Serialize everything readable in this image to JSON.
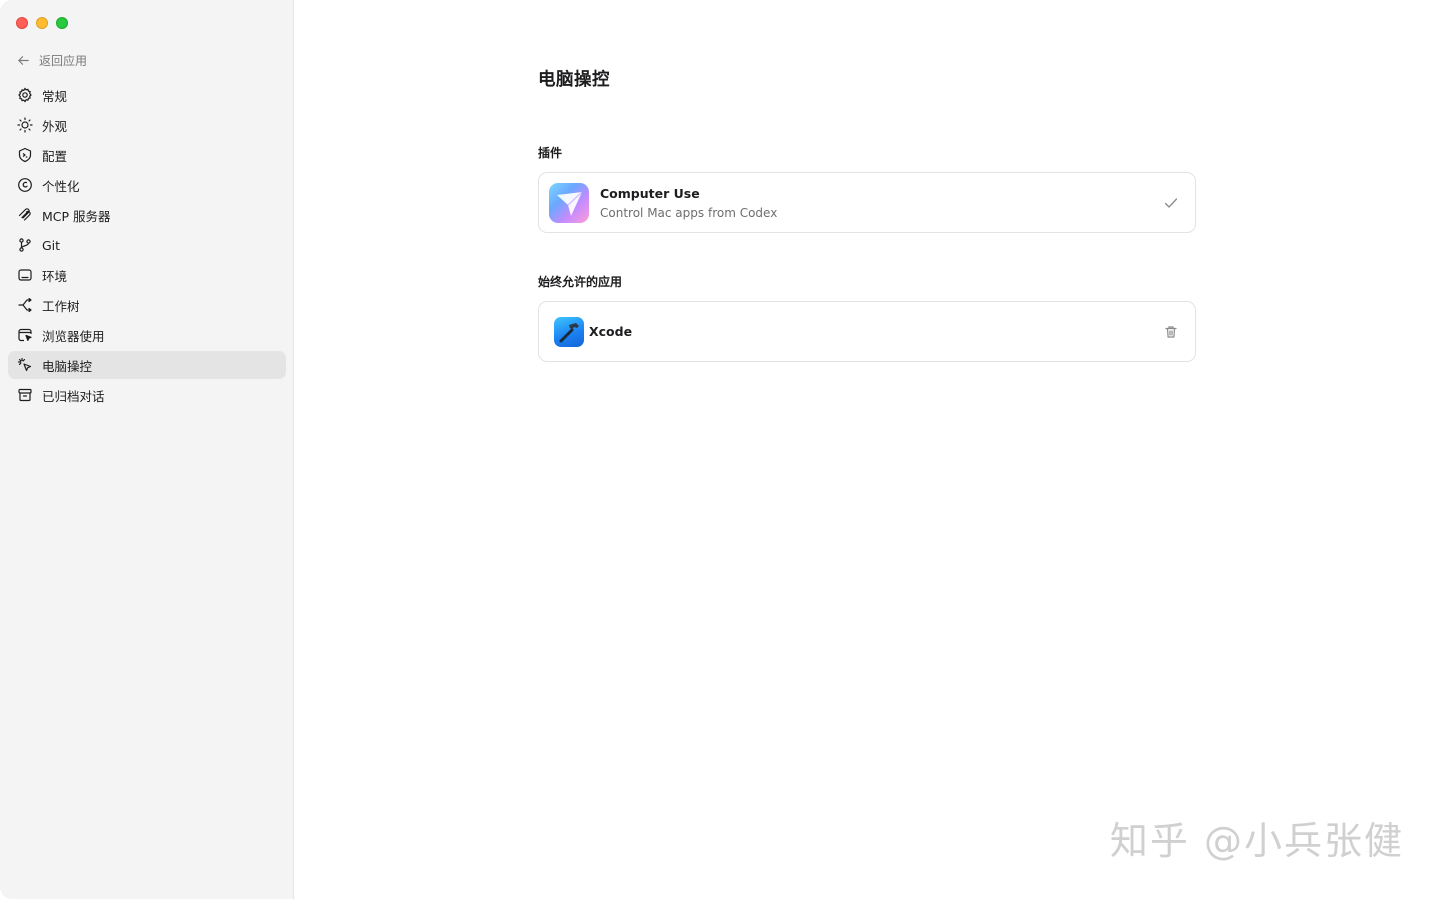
{
  "sidebar": {
    "back_label": "返回应用",
    "items": [
      {
        "label": "常规",
        "icon": "gear-icon"
      },
      {
        "label": "外观",
        "icon": "sun-icon"
      },
      {
        "label": "配置",
        "icon": "shield-icon"
      },
      {
        "label": "个性化",
        "icon": "personalize-icon"
      },
      {
        "label": "MCP 服务器",
        "icon": "mcp-icon"
      },
      {
        "label": "Git",
        "icon": "git-branch-icon"
      },
      {
        "label": "环境",
        "icon": "monitor-icon"
      },
      {
        "label": "工作树",
        "icon": "worktree-icon"
      },
      {
        "label": "浏览器使用",
        "icon": "browser-cursor-icon"
      },
      {
        "label": "电脑操控",
        "icon": "pointer-click-icon",
        "active": true
      },
      {
        "label": "已归档对话",
        "icon": "archive-icon"
      }
    ]
  },
  "main": {
    "title": "电脑操控",
    "plugins_section": "插件",
    "plugin": {
      "title": "Computer Use",
      "subtitle": "Control Mac apps from Codex",
      "icon": "computer-use-app-icon",
      "status_icon": "check-icon"
    },
    "allowed_section": "始终允许的应用",
    "allowed_app": {
      "title": "Xcode",
      "icon": "xcode-app-icon",
      "action_icon": "trash-icon"
    }
  },
  "watermark": "知乎 @小兵张健",
  "colors": {
    "sidebar_bg": "#f4f4f4",
    "active_item_bg": "#e4e4e4",
    "border": "#e3e3e3",
    "secondary_text": "#6e6e6e"
  }
}
